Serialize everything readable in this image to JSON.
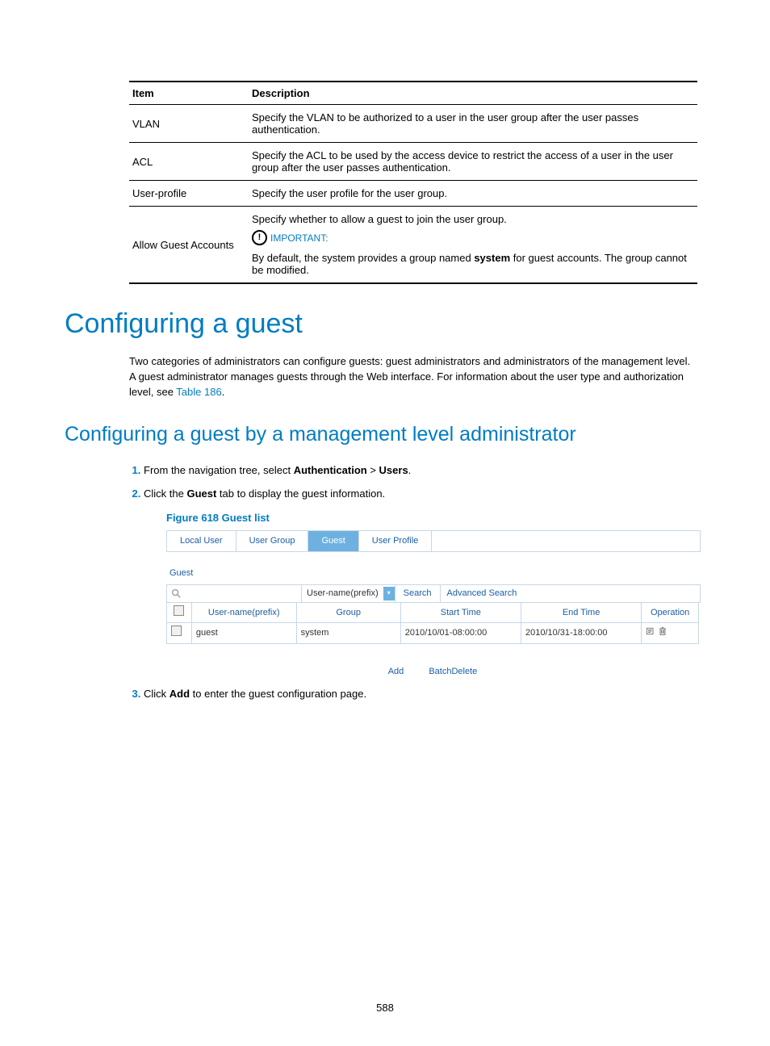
{
  "table": {
    "headers": [
      "Item",
      "Description"
    ],
    "rows": {
      "vlan": {
        "item": "VLAN",
        "desc": "Specify the VLAN to be authorized to a user in the user group after the user passes authentication."
      },
      "acl": {
        "item": "ACL",
        "desc": "Specify the ACL to be used by the access device to restrict the access of a user in the user group after the user passes authentication."
      },
      "userprofile": {
        "item": "User-profile",
        "desc": "Specify the user profile for the user group."
      },
      "allowguest": {
        "item": "Allow Guest Accounts",
        "line1": "Specify whether to allow a guest to join the user group.",
        "important_label": "IMPORTANT:",
        "line2_pre": "By default, the system provides a group named ",
        "line2_bold": "system",
        "line2_post": " for guest accounts. The group cannot be modified."
      }
    }
  },
  "h1": "Configuring a guest",
  "intro": {
    "pre": "Two categories of administrators can configure guests: guest administrators and administrators of the management level. A guest administrator manages guests through the Web interface. For information about the user type and authorization level, see ",
    "link": "Table 186",
    "post": "."
  },
  "h2": "Configuring a guest by a management level administrator",
  "steps": {
    "s1_pre": "From the navigation tree, select ",
    "s1_b1": "Authentication",
    "s1_mid": " > ",
    "s1_b2": "Users",
    "s1_post": ".",
    "s2_pre": "Click the ",
    "s2_b": "Guest",
    "s2_post": " tab to display the guest information.",
    "s3_pre": "Click ",
    "s3_b": "Add",
    "s3_post": " to enter the guest configuration page."
  },
  "figure_title": "Figure 618 Guest list",
  "ui": {
    "tabs": {
      "local_user": "Local User",
      "user_group": "User Group",
      "guest": "Guest",
      "user_profile": "User Profile"
    },
    "section": "Guest",
    "filter_option": "User-name(prefix)",
    "search": "Search",
    "advanced": "Advanced Search",
    "cols": {
      "c1": "User-name(prefix)",
      "c2": "Group",
      "c3": "Start Time",
      "c4": "End Time",
      "c5": "Operation"
    },
    "row": {
      "user": "guest",
      "group": "system",
      "start": "2010/10/01-08:00:00",
      "end": "2010/10/31-18:00:00"
    },
    "add": "Add",
    "batch_delete": "BatchDelete"
  },
  "page_num": "588"
}
